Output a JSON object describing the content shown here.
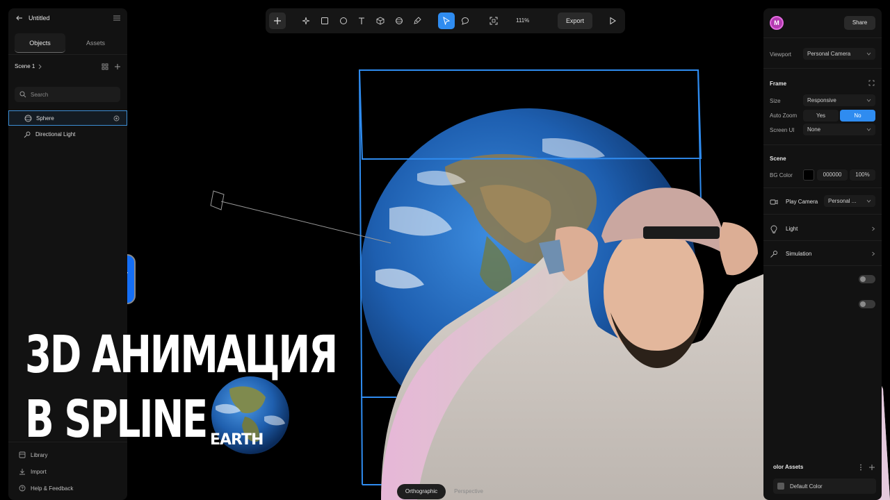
{
  "left_panel": {
    "file_title": "Untitled",
    "tabs": [
      {
        "label": "Objects"
      },
      {
        "label": "Assets"
      }
    ],
    "scene_label": "Scene 1",
    "search_placeholder": "Search",
    "objects": [
      {
        "label": "Sphere",
        "icon": "sphere-icon",
        "selected": true
      },
      {
        "label": "Directional Light",
        "icon": "light-icon",
        "selected": false
      }
    ],
    "bottom_items": [
      {
        "label": "Library",
        "icon": "library-icon"
      },
      {
        "label": "Import",
        "icon": "import-icon"
      },
      {
        "label": "Help & Feedback",
        "icon": "help-icon"
      }
    ]
  },
  "toolbar": {
    "tools": [
      "add-icon",
      "magic-icon",
      "rectangle-icon",
      "ellipse-icon",
      "text-icon",
      "cube-icon",
      "sphere-icon",
      "pen-icon",
      "select-icon",
      "comment-icon",
      "frame-icon"
    ],
    "zoom": "111%",
    "export_label": "Export",
    "play_icon": "play-icon"
  },
  "right_panel": {
    "avatar_initial": "M",
    "share_label": "Share",
    "viewport_label": "Viewport",
    "viewport_value": "Personal Camera",
    "frame_title": "Frame",
    "size_label": "Size",
    "size_value": "Responsive",
    "auto_zoom_label": "Auto Zoom",
    "auto_zoom_yes": "Yes",
    "auto_zoom_no": "No",
    "screen_ui_label": "Screen UI",
    "screen_ui_value": "None",
    "scene_title": "Scene",
    "bg_color_label": "BG Color",
    "bg_color_hex": "000000",
    "bg_color_opacity": "100%",
    "play_camera_label": "Play Camera",
    "play_camera_value": "Personal ...",
    "light_label": "Light",
    "simulation_label": "Simulation",
    "color_assets_title": "olor Assets",
    "default_color_label": "Default Color"
  },
  "viewport": {
    "camera_modes": [
      {
        "label": "Orthographic",
        "active": true
      },
      {
        "label": "Perspective",
        "active": false
      }
    ]
  },
  "overlay": {
    "headline_line1": "3D АНИМАЦИЯ",
    "headline_line2": "В SPLINE",
    "earth_label": "EARTH"
  },
  "colors": {
    "accent": "#2f8cf0",
    "frame_outline": "#2f8cf0",
    "panel_bg": "#121212",
    "avatar": "#b33bb0"
  }
}
